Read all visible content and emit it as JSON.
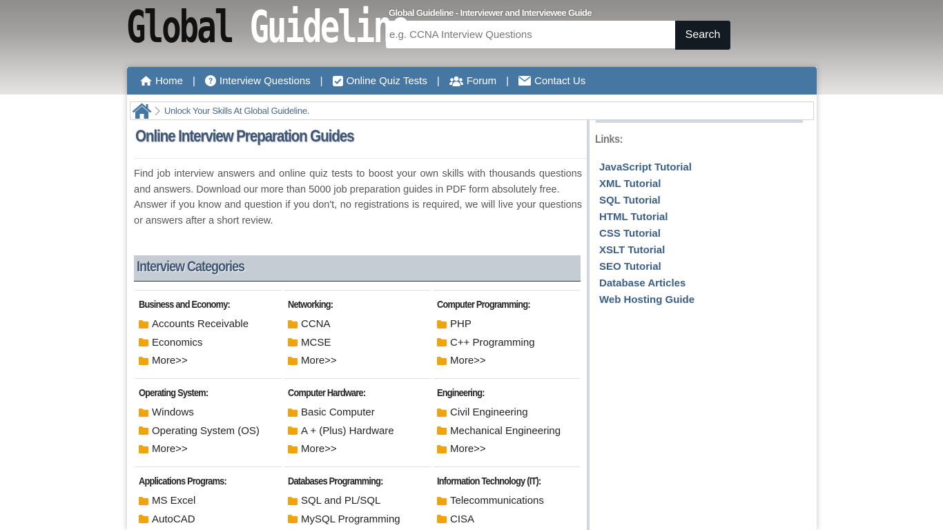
{
  "header": {
    "logo_part1": "Global",
    "logo_part2": "Guideline",
    "tagline": "Global Guideline - Interviewer and Interviewee Guide",
    "search_placeholder": "e.g. CCNA Interview Questions",
    "search_button": "Search"
  },
  "nav": {
    "separator": "|",
    "items": [
      {
        "label": "Home",
        "icon": "home-icon"
      },
      {
        "label": "Interview Questions",
        "icon": "question-circle-icon"
      },
      {
        "label": "Online Quiz Tests",
        "icon": "checkbox-icon"
      },
      {
        "label": "Forum",
        "icon": "users-icon"
      },
      {
        "label": "Contact Us",
        "icon": "envelope-icon"
      }
    ]
  },
  "breadcrumb": {
    "text": "Unlock Your Skills At Global Guideline."
  },
  "main": {
    "title": "Online Interview Preparation Guides",
    "intro_p1": "Find job interview answers and online quiz tests to boost your own skills with thousands questions and answers. Download our more than 5000 job preparation guides in PDF form absolutely free.",
    "intro_p2": "Answer if you know and question if you don't, no registrations is required, we will live your questions or answers after a short review.",
    "categories_heading": "Interview Categories",
    "categories": [
      [
        {
          "title": "Business and Economy:",
          "links": [
            "Accounts Receivable",
            "Economics",
            "More>>"
          ]
        },
        {
          "title": "Networking:",
          "links": [
            "CCNA",
            "MCSE",
            "More>>"
          ]
        },
        {
          "title": "Computer Programming:",
          "links": [
            "PHP",
            "C++ Programming",
            "More>>"
          ]
        }
      ],
      [
        {
          "title": "Operating System:",
          "links": [
            "Windows",
            "Operating System (OS)",
            "More>>"
          ]
        },
        {
          "title": "Computer Hardware:",
          "links": [
            "Basic Computer",
            "A + (Plus) Hardware",
            "More>>"
          ]
        },
        {
          "title": "Engineering:",
          "links": [
            "Civil Engineering",
            "Mechanical Engineering",
            "More>>"
          ]
        }
      ],
      [
        {
          "title": "Applications Programs:",
          "links": [
            "MS Excel",
            "AutoCAD"
          ]
        },
        {
          "title": "Databases Programming:",
          "links": [
            "SQL and PL/SQL",
            "MySQL Programming"
          ]
        },
        {
          "title": "Information Technology (IT):",
          "links": [
            "Telecommunications",
            "CISA"
          ]
        }
      ]
    ]
  },
  "sidebar": {
    "title": "Links:",
    "links": [
      "JavaScript Tutorial",
      "XML Tutorial",
      "SQL Tutorial",
      "HTML Tutorial",
      "CSS Tutorial",
      "XSLT Tutorial",
      "SEO Tutorial",
      "Database Articles",
      "Web Hosting Guide"
    ]
  },
  "colors": {
    "nav_bg": "#4677a2",
    "folder_icon": "#f0a30a",
    "link": "#3a5e87",
    "heading": "#3e5775"
  }
}
